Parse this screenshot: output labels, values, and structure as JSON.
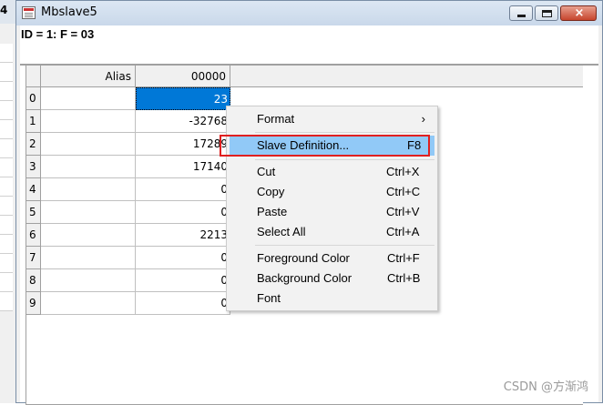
{
  "background_window": {
    "title_fragment": "4"
  },
  "window": {
    "title": "Mbslave5",
    "status_line": "ID = 1: F = 03",
    "buttons": {
      "minimize": "minimize",
      "maximize": "maximize",
      "close": "close"
    }
  },
  "grid": {
    "headers": {
      "alias": "Alias",
      "address": "00000"
    },
    "rows": [
      {
        "index": "0",
        "alias": "",
        "value": "23"
      },
      {
        "index": "1",
        "alias": "",
        "value": "-32768"
      },
      {
        "index": "2",
        "alias": "",
        "value": "17289"
      },
      {
        "index": "3",
        "alias": "",
        "value": "17140"
      },
      {
        "index": "4",
        "alias": "",
        "value": "0"
      },
      {
        "index": "5",
        "alias": "",
        "value": "0"
      },
      {
        "index": "6",
        "alias": "",
        "value": "2213"
      },
      {
        "index": "7",
        "alias": "",
        "value": "0"
      },
      {
        "index": "8",
        "alias": "",
        "value": "0"
      },
      {
        "index": "9",
        "alias": "",
        "value": "0"
      }
    ],
    "selected_row": 0
  },
  "context_menu": {
    "items": [
      {
        "label": "Format",
        "shortcut": "",
        "submenu": true
      },
      {
        "label": "Slave Definition...",
        "shortcut": "F8",
        "highlighted": true
      },
      {
        "label": "Cut",
        "shortcut": "Ctrl+X"
      },
      {
        "label": "Copy",
        "shortcut": "Ctrl+C"
      },
      {
        "label": "Paste",
        "shortcut": "Ctrl+V"
      },
      {
        "label": "Select All",
        "shortcut": "Ctrl+A"
      },
      {
        "label": "Foreground Color",
        "shortcut": "Ctrl+F"
      },
      {
        "label": "Background Color",
        "shortcut": "Ctrl+B"
      },
      {
        "label": "Font",
        "shortcut": ""
      }
    ]
  },
  "colors": {
    "selection": "#0078d7",
    "menu_highlight": "#91c9f7",
    "annotation": "#e02020"
  },
  "watermark": "CSDN @方渐鸿"
}
